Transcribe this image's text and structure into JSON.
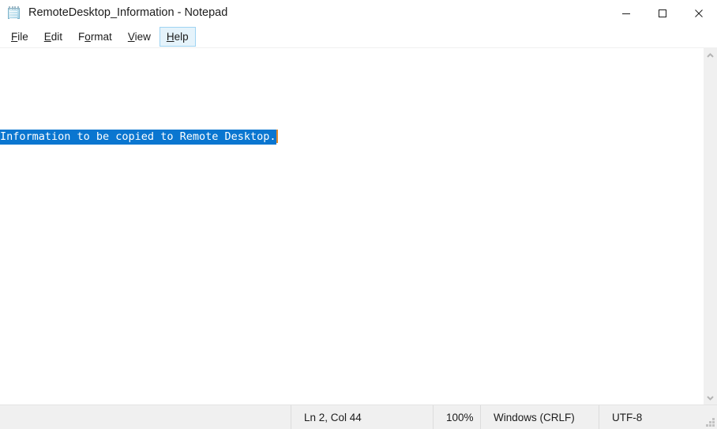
{
  "window": {
    "title": "RemoteDesktop_Information - Notepad",
    "icon": "notepad-icon",
    "controls": {
      "minimize": "minimize-icon",
      "maximize": "maximize-icon",
      "close": "close-icon"
    }
  },
  "menubar": {
    "items": [
      {
        "label": "File",
        "accel": "F",
        "rest": "ile",
        "hovered": false
      },
      {
        "label": "Edit",
        "accel": "E",
        "rest": "dit",
        "hovered": false
      },
      {
        "label": "Format",
        "accel": "F",
        "rest": "ormat",
        "hovered": false,
        "pre": "F",
        "mid": "o",
        "post": "rmat",
        "style": "mid"
      },
      {
        "label": "View",
        "accel": "V",
        "rest": "iew",
        "hovered": false
      },
      {
        "label": "Help",
        "accel": "H",
        "rest": "elp",
        "hovered": true
      }
    ]
  },
  "editor": {
    "line1": "",
    "selected_text": "Information to be copied to Remote Desktop.",
    "selection_color": "#0a76d0",
    "selection_text_color": "#ffffff",
    "caret_color": "#e08a2e"
  },
  "scrollbar": {
    "up_arrow": "chevron-up-icon",
    "down_arrow": "chevron-down-icon"
  },
  "statusbar": {
    "position": "Ln 2, Col 44",
    "zoom": "100%",
    "line_ending": "Windows (CRLF)",
    "encoding": "UTF-8",
    "grip": "resize-grip-icon"
  }
}
